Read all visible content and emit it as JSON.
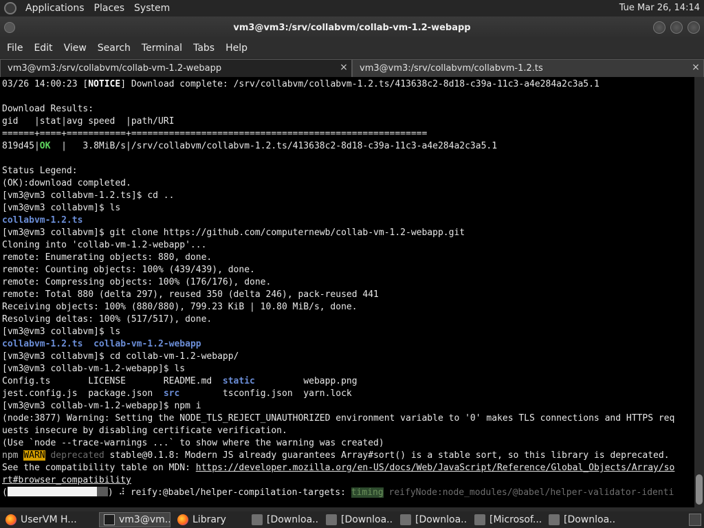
{
  "panel": {
    "menus": [
      "Applications",
      "Places",
      "System"
    ],
    "clock": "Tue Mar 26, 14:14"
  },
  "window": {
    "title": "vm3@vm3:/srv/collabvm/collab-vm-1.2-webapp"
  },
  "menubar": [
    "File",
    "Edit",
    "View",
    "Search",
    "Terminal",
    "Tabs",
    "Help"
  ],
  "tabs": [
    {
      "label": "vm3@vm3:/srv/collabvm/collab-vm-1.2-webapp",
      "close": "×"
    },
    {
      "label": "vm3@vm3:/srv/collabvm/collabvm-1.2.ts",
      "close": "×"
    }
  ],
  "terminal": {
    "l01a": "03/26 14:00:23 [",
    "l01b": "NOTICE",
    "l01c": "] Download complete: /srv/collabvm/collabvm-1.2.ts/413638c2-8d18-c39a-11c3-a4e284a2c3a5.1",
    "l02": "",
    "l03": "Download Results:",
    "l04": "gid   |stat|avg speed  |path/URI",
    "l05": "======+====+===========+=======================================================",
    "l06a": "819d45|",
    "l06b": "OK",
    "l06c": "  |   3.8MiB/s|/srv/collabvm/collabvm-1.2.ts/413638c2-8d18-c39a-11c3-a4e284a2c3a5.1",
    "l07": "",
    "l08": "Status Legend:",
    "l09": "(OK):download completed.",
    "l10": "[vm3@vm3 collabvm-1.2.ts]$ cd ..",
    "l11": "[vm3@vm3 collabvm]$ ls",
    "l12": "collabvm-1.2.ts",
    "l13": "[vm3@vm3 collabvm]$ git clone https://github.com/computernewb/collab-vm-1.2-webapp.git",
    "l14": "Cloning into 'collab-vm-1.2-webapp'...",
    "l15": "remote: Enumerating objects: 880, done.",
    "l16": "remote: Counting objects: 100% (439/439), done.",
    "l17": "remote: Compressing objects: 100% (176/176), done.",
    "l18": "remote: Total 880 (delta 297), reused 350 (delta 246), pack-reused 441",
    "l19": "Receiving objects: 100% (880/880), 799.23 KiB | 10.80 MiB/s, done.",
    "l20": "Resolving deltas: 100% (517/517), done.",
    "l21": "[vm3@vm3 collabvm]$ ls",
    "l22a": "collabvm-1.2.ts",
    "l22b": "collab-vm-1.2-webapp",
    "l23": "[vm3@vm3 collabvm]$ cd collab-vm-1.2-webapp/",
    "l24": "[vm3@vm3 collab-vm-1.2-webapp]$ ls",
    "l25a": "Config.ts       LICENSE       README.md  ",
    "l25b": "static",
    "l25c": "         webapp.png",
    "l26a": "jest.config.js  package.json  ",
    "l26b": "src",
    "l26c": "        tsconfig.json  yarn.lock",
    "l27": "[vm3@vm3 collab-vm-1.2-webapp]$ npm i",
    "l28": "(node:3877) Warning: Setting the NODE_TLS_REJECT_UNAUTHORIZED environment variable to '0' makes TLS connections and HTTPS req",
    "l29": "uests insecure by disabling certificate verification.",
    "l30": "(Use `node --trace-warnings ...` to show where the warning was created)",
    "l31a": "npm",
    "l31b": "WARN",
    "l31c": "deprecated",
    "l31d": " stable@0.1.8: Modern JS already guarantees Array#sort() is a stable sort, so this library is deprecated.",
    "l32a": "See the compatibility table on MDN: ",
    "l32b": "https://developer.mozilla.org/en-US/docs/Web/JavaScript/Reference/Global_Objects/Array/so",
    "l33": "rt#browser_compatibility",
    "l34a": "(",
    "l34b": ") ⠼ reify:@babel/helper-compilation-targets: ",
    "l34c": "timing",
    "l34d": " reifyNode:node_modules/@babel/helper-validator-identi"
  },
  "taskbar": [
    {
      "label": "UserVM H...",
      "icon": "firefox-icon"
    },
    {
      "label": "vm3@vm...",
      "icon": "terminal-icon"
    },
    {
      "label": "Library",
      "icon": "firefox-icon"
    },
    {
      "label": "[Downloa...",
      "icon": "folder-icon"
    },
    {
      "label": "[Downloa...",
      "icon": "folder-icon"
    },
    {
      "label": "[Downloa...",
      "icon": "folder-icon"
    },
    {
      "label": "[Microsof...",
      "icon": "folder-icon"
    },
    {
      "label": "[Downloa...",
      "icon": "folder-icon"
    }
  ]
}
